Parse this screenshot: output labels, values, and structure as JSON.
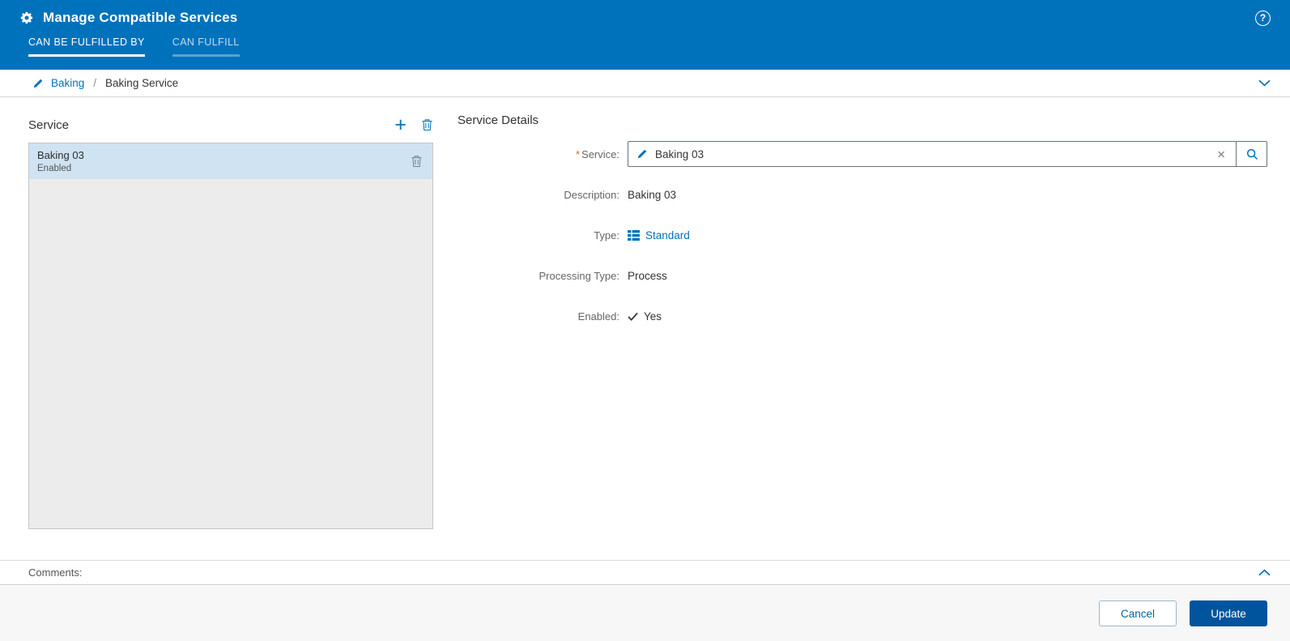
{
  "colors": {
    "header_blue": "#0072bc",
    "accent_blue": "#0072bc",
    "update_button_blue": "#00549e",
    "selected_item_blue": "#cfe3f2",
    "required_mark_orange": "#cf6d17"
  },
  "header": {
    "title": "Manage Compatible Services",
    "help_glyph": "?",
    "tabs": [
      {
        "label": "CAN BE FULFILLED BY",
        "active": true
      },
      {
        "label": "CAN FULFILL",
        "active": false
      }
    ]
  },
  "breadcrumb": {
    "link": "Baking",
    "separator": "/",
    "current": "Baking Service"
  },
  "service_panel": {
    "title": "Service",
    "add_glyph": "+",
    "items": [
      {
        "name": "Baking 03",
        "status": "Enabled",
        "selected": true
      }
    ]
  },
  "details": {
    "title": "Service Details",
    "rows": {
      "service": {
        "required_mark": "*",
        "label": "Service:",
        "value": "Baking 03",
        "clear_glyph": "×"
      },
      "description": {
        "label": "Description:",
        "value": "Baking 03"
      },
      "type": {
        "label": "Type:",
        "value": "Standard"
      },
      "processing": {
        "label": "Processing Type:",
        "value": "Process"
      },
      "enabled": {
        "label": "Enabled:",
        "value": "Yes"
      }
    }
  },
  "comments": {
    "label": "Comments:"
  },
  "footer": {
    "cancel_label": "Cancel",
    "update_label": "Update"
  }
}
